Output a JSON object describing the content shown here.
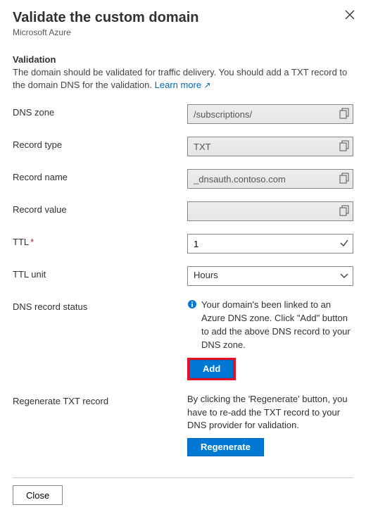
{
  "header": {
    "title": "Validate the custom domain",
    "subtitle": "Microsoft Azure"
  },
  "section": {
    "heading": "Validation",
    "description": "The domain should be validated for traffic delivery. You should add a TXT record to the domain DNS for the validation.",
    "learn_more": "Learn more"
  },
  "fields": {
    "dns_zone": {
      "label": "DNS zone",
      "value": "/subscriptions/"
    },
    "record_type": {
      "label": "Record type",
      "value": "TXT"
    },
    "record_name": {
      "label": "Record name",
      "value": "_dnsauth.contoso.com"
    },
    "record_value": {
      "label": "Record value",
      "value": ""
    },
    "ttl": {
      "label": "TTL",
      "value": "1",
      "required": true
    },
    "ttl_unit": {
      "label": "TTL unit",
      "value": "Hours"
    }
  },
  "dns_status": {
    "label": "DNS record status",
    "message": "Your domain's been linked to an Azure DNS zone. Click \"Add\" button to add the above DNS record to your DNS zone.",
    "button": "Add"
  },
  "regenerate": {
    "label": "Regenerate TXT record",
    "message": "By clicking the 'Regenerate' button, you have to re-add the TXT record to your DNS provider for validation.",
    "button": "Regenerate"
  },
  "footer": {
    "close": "Close"
  },
  "colors": {
    "primary": "#0078d4",
    "link": "#0067b8",
    "error": "#e81123"
  }
}
